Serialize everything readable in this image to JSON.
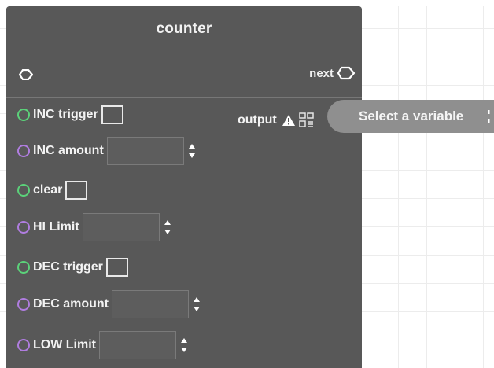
{
  "node": {
    "title": "counter",
    "next_label": "next",
    "output_label": "output",
    "variable_placeholder": "Select a variable"
  },
  "inputs": [
    {
      "label": "INC trigger",
      "type": "trigger",
      "port_color": "#5bd27a"
    },
    {
      "label": "INC amount",
      "type": "number",
      "port_color": "#b07de0"
    },
    {
      "label": "clear",
      "type": "trigger",
      "port_color": "#5bd27a"
    },
    {
      "label": "HI Limit",
      "type": "number",
      "port_color": "#b07de0"
    },
    {
      "label": "DEC trigger",
      "type": "trigger",
      "port_color": "#5bd27a"
    },
    {
      "label": "DEC amount",
      "type": "number",
      "port_color": "#b07de0"
    },
    {
      "label": "LOW Limit",
      "type": "number",
      "port_color": "#b07de0"
    }
  ],
  "icons": {
    "flow_in": "flow-in-port-icon",
    "flow_next": "flow-next-port-icon",
    "warning": "warning-icon",
    "variable": "variable-icon",
    "spinner": "spinner-arrows-icon"
  },
  "colors": {
    "node_bg": "#585858",
    "trigger_port": "#5bd27a",
    "number_port": "#b07de0",
    "select_bg": "#8f8f8f"
  }
}
